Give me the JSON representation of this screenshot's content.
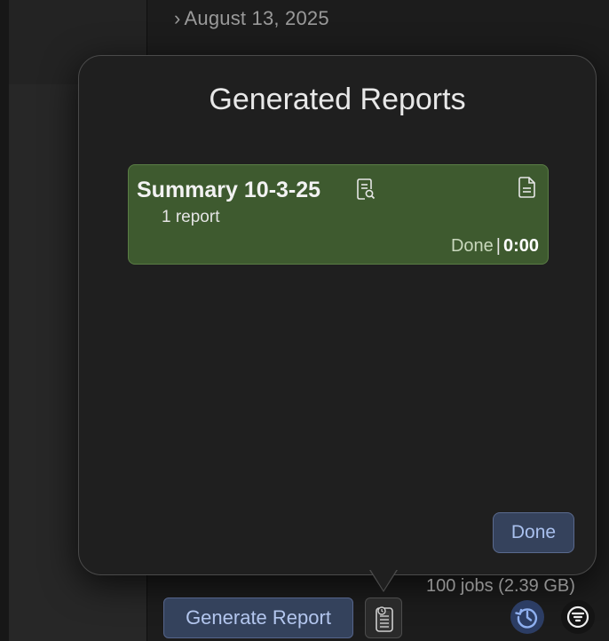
{
  "timeline": {
    "chevron": "›",
    "date_label": "August 13, 2025"
  },
  "popover": {
    "title": "Generated Reports",
    "reports": [
      {
        "name": "Summary 10-3-25",
        "count_label": "1 report",
        "status": "Done",
        "separator": "|",
        "elapsed": "0:00",
        "color": "#3e5a2f",
        "icons": [
          "preview-document-icon",
          "document-icon"
        ]
      }
    ],
    "done_label": "Done"
  },
  "footer": {
    "jobs_info": "100 jobs (2.39 GB)",
    "generate_label": "Generate Report",
    "icons": [
      "reports-list-icon",
      "history-icon",
      "filter-icon"
    ],
    "accent_color": "#34425c"
  }
}
